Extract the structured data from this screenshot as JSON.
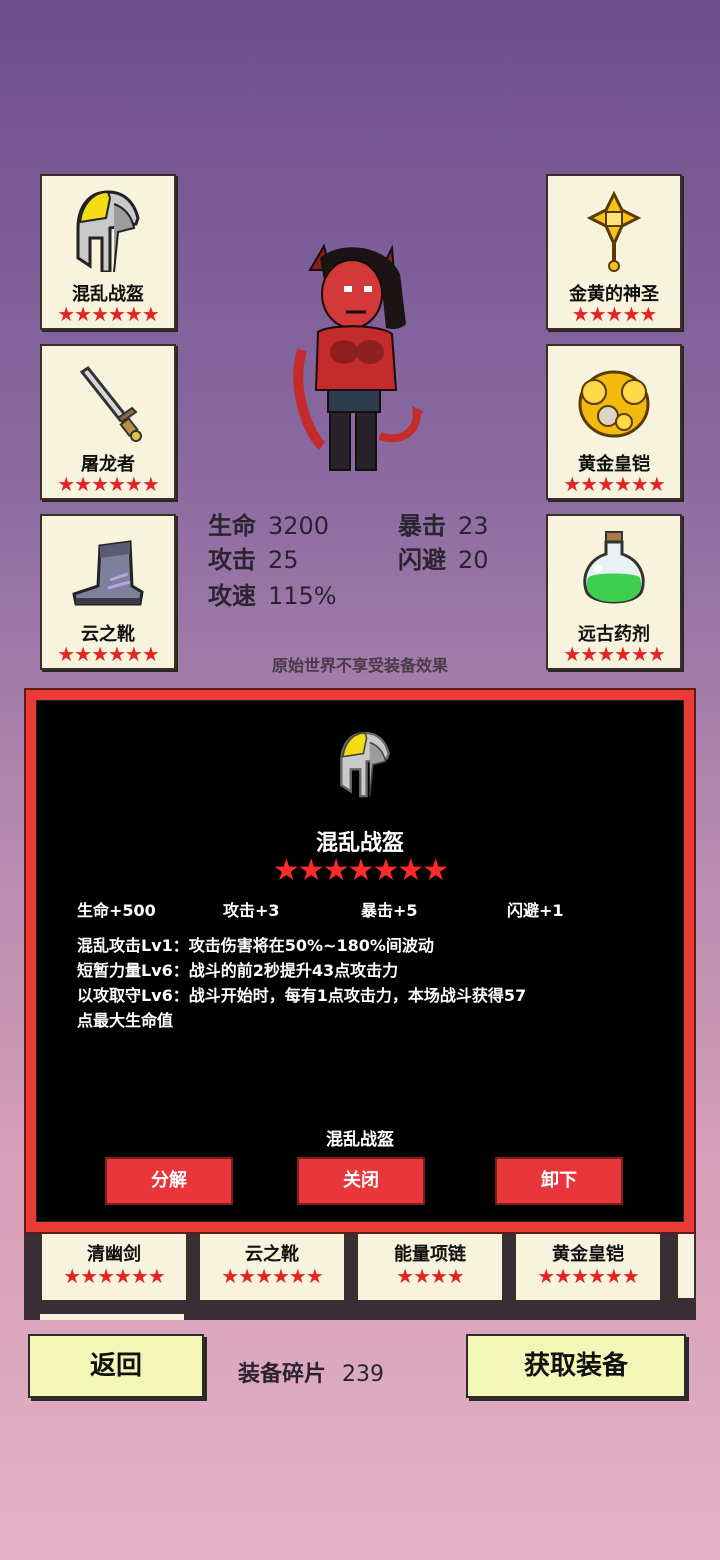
{
  "equip_slots": {
    "left": [
      {
        "name": "混乱战盔",
        "stars": "★★★★★★",
        "icon": "helmet-icon"
      },
      {
        "name": "屠龙者",
        "stars": "★★★★★★",
        "icon": "dagger-icon"
      },
      {
        "name": "云之靴",
        "stars": "★★★★★★",
        "icon": "boot-icon"
      }
    ],
    "right": [
      {
        "name": "金黄的神圣",
        "stars": "★★★★★",
        "icon": "holy-cross-icon"
      },
      {
        "name": "黄金皇铠",
        "stars": "★★★★★★",
        "icon": "gold-armor-icon"
      },
      {
        "name": "远古药剂",
        "stars": "★★★★★★",
        "icon": "potion-icon"
      }
    ]
  },
  "stats": {
    "hp_label": "生命",
    "hp": "3200",
    "atk_label": "攻击",
    "atk": "25",
    "aspd_label": "攻速",
    "aspd": "115%",
    "crit_label": "暴击",
    "crit": "23",
    "dodge_label": "闪避",
    "dodge": "20"
  },
  "hint": "原始世界不享受装备效果",
  "modal": {
    "icon": "helmet-icon",
    "title": "混乱战盔",
    "stars": "★★★★★★★",
    "bonuses": [
      "生命+500",
      "攻击+3",
      "暴击+5",
      "闪避+1"
    ],
    "skills": [
      "混乱攻击Lv1：攻击伤害将在50%~180%间波动",
      "短暂力量Lv6：战斗的前2秒提升43点攻击力",
      "以攻取守Lv6：战斗开始时，每有1点攻击力，本场战斗获得57",
      "点最大生命值"
    ],
    "item_name": "混乱战盔",
    "buttons": {
      "decompose": "分解",
      "close": "关闭",
      "unequip": "卸下"
    }
  },
  "inventory": [
    {
      "name": "清幽剑",
      "stars": "★★★★★★"
    },
    {
      "name": "云之靴",
      "stars": "★★★★★★"
    },
    {
      "name": "能量项链",
      "stars": "★★★★"
    },
    {
      "name": "黄金皇铠",
      "stars": "★★★★★★"
    }
  ],
  "bottom": {
    "back": "返回",
    "fragments_label": "装备碎片",
    "fragments": "239",
    "get_equip": "获取装备"
  },
  "colors": {
    "star_red": "#e42323",
    "modal_border": "#ea3b35",
    "button_yellow": "#f2f7b8"
  }
}
